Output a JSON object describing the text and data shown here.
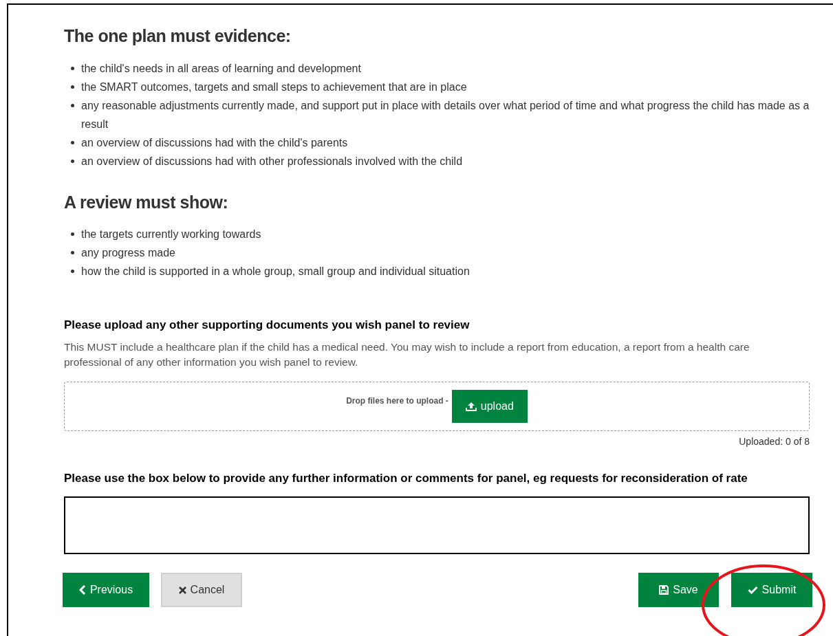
{
  "sections": [
    {
      "heading": "The one plan must evidence:",
      "items": [
        "the child's needs in all areas of learning and development",
        "the SMART outcomes, targets and small steps to achievement that are in place",
        "any reasonable adjustments currently made, and support put in place with details over what period of time and what progress the child has made as a result",
        "an overview of discussions had with the child's parents",
        "an overview of discussions had with other professionals involved with the child"
      ]
    },
    {
      "heading": "A review must show:",
      "items": [
        "the targets currently working towards",
        "any progress made",
        "how the child is supported in a whole group, small group and individual situation"
      ]
    }
  ],
  "upload": {
    "label": "Please upload any other supporting documents you wish panel to review",
    "help": "This MUST include a healthcare plan if the child has a medical need. You may wish to include a report from education, a report from a health care professional of any other information you wish panel to review.",
    "drop_text": "Drop files here to upload -",
    "button": "upload",
    "status": "Uploaded: 0 of 8"
  },
  "comments": {
    "label": "Please use the box below to provide any further information or comments for panel, eg requests for reconsideration of rate"
  },
  "buttons": [
    {
      "kind": "previous",
      "label": "Previous"
    },
    {
      "kind": "cancel",
      "label": "Cancel"
    },
    {
      "kind": "save",
      "label": "Save"
    },
    {
      "kind": "submit",
      "label": "Submit"
    }
  ],
  "annotation": {
    "kind": "ellipse",
    "color": "#e8141b"
  }
}
